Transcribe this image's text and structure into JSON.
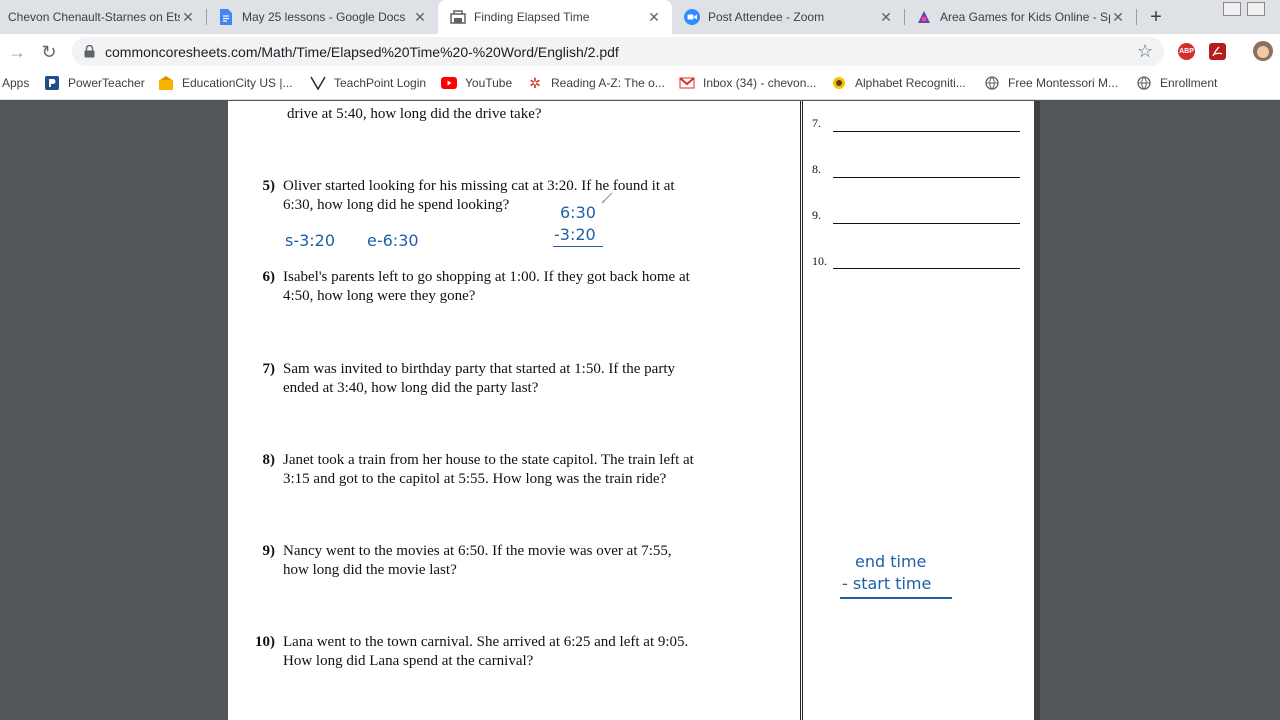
{
  "tabs": [
    {
      "title": "Chevon Chenault-Starnes on Etsy",
      "icon": "etsy-icon",
      "active": false
    },
    {
      "title": "May 25 lessons - Google Docs",
      "icon": "google-docs-icon",
      "active": false
    },
    {
      "title": "Finding Elapsed Time",
      "icon": "worksheet-icon",
      "active": true
    },
    {
      "title": "Post Attendee - Zoom",
      "icon": "zoom-icon",
      "active": false
    },
    {
      "title": "Area Games for Kids Online - Sp",
      "icon": "game-icon",
      "active": false
    }
  ],
  "toolbar": {
    "url": "commoncoresheets.com/Math/Time/Elapsed%20Time%20-%20Word/English/2.pdf",
    "ext_abp": "ABP"
  },
  "bookmarks": [
    {
      "label": "Apps",
      "icon": "apps-grid-icon"
    },
    {
      "label": "PowerTeacher",
      "icon": "powerteacher-icon"
    },
    {
      "label": "EducationCity US |...",
      "icon": "educationcity-icon"
    },
    {
      "label": "TeachPoint Login",
      "icon": "teachpoint-icon"
    },
    {
      "label": "YouTube",
      "icon": "youtube-icon"
    },
    {
      "label": "Reading A-Z: The o...",
      "icon": "reading-az-icon"
    },
    {
      "label": "Inbox (34) - chevon...",
      "icon": "gmail-icon"
    },
    {
      "label": "Alphabet Recogniti...",
      "icon": "sunflower-icon"
    },
    {
      "label": "Free Montessori M...",
      "icon": "globe-icon"
    },
    {
      "label": "Enrollment",
      "icon": "globe-icon"
    }
  ],
  "worksheet": {
    "partial_question": "drive at 5:40, how long did the drive take?",
    "questions": [
      {
        "num": "5)",
        "line1": "Oliver started looking for his missing cat at 3:20. If he found it at",
        "line2": "6:30, how long did he spend looking?"
      },
      {
        "num": "6)",
        "line1": "Isabel's parents left to go shopping at 1:00. If they got back home at",
        "line2": "4:50, how long were they gone?"
      },
      {
        "num": "7)",
        "line1": "Sam was invited to birthday party that started at 1:50. If the party",
        "line2": "ended at 3:40, how long did the party last?"
      },
      {
        "num": "8)",
        "line1": "Janet took a train from her house to the state capitol. The train left at",
        "line2": "3:15 and got to the capitol at 5:55. How long was the train ride?"
      },
      {
        "num": "9)",
        "line1": "Nancy went to the movies at 6:50. If the movie was over at 7:55,",
        "line2": "how long did the movie last?"
      },
      {
        "num": "10)",
        "line1": "Lana went to the town carnival. She arrived at 6:25 and left at 9:05.",
        "line2": "How long did Lana spend at the carnival?"
      }
    ],
    "answer_labels": [
      "7.",
      "8.",
      "9.",
      "10."
    ]
  },
  "annotations": {
    "start": "s-3:20",
    "end": "e-6:30",
    "sub_top": "6:30",
    "sub_bottom": "-3:20",
    "formula_line1": "end time",
    "formula_line2": "- start time"
  },
  "colors": {
    "ink": "#1f5fa8",
    "pdf_background": "#525659"
  }
}
